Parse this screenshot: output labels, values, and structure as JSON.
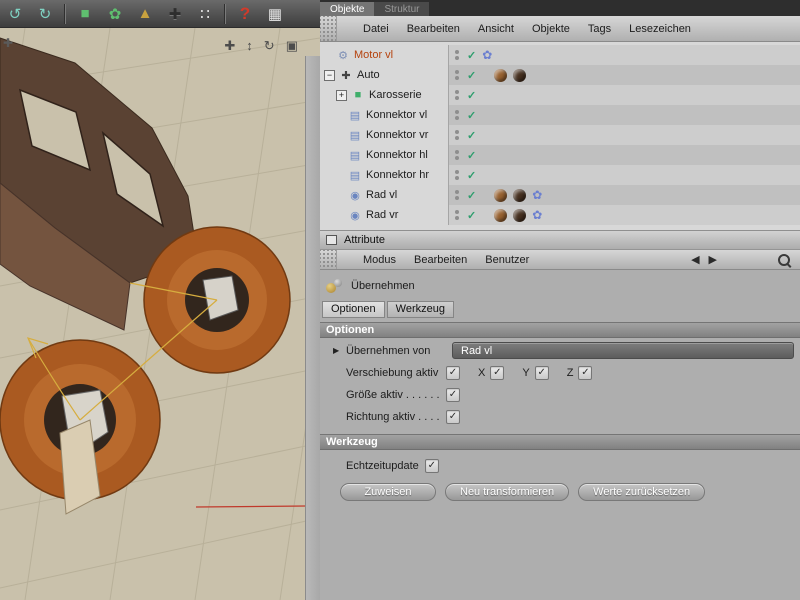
{
  "colors": {
    "accent_selected_object": "#b5430e",
    "check_green": "#2f9e6e",
    "wheel_orange": "#aa5a21",
    "body_brown": "#5a4233"
  },
  "toolbar": {
    "icons": [
      {
        "name": "undo",
        "glyph": "↺"
      },
      {
        "name": "redo",
        "glyph": "↻"
      },
      {
        "name": "cube-primitive",
        "glyph": "■"
      },
      {
        "name": "modeling-flower",
        "glyph": "✿"
      },
      {
        "name": "cone-primitive",
        "glyph": "▲"
      },
      {
        "name": "move-tool",
        "glyph": "✚"
      },
      {
        "name": "particles",
        "glyph": "∷"
      },
      {
        "name": "help",
        "glyph": "?"
      },
      {
        "name": "content-browser",
        "glyph": "▦"
      }
    ]
  },
  "viewport": {
    "nav": [
      {
        "name": "pan",
        "glyph": "✚"
      },
      {
        "name": "dolly",
        "glyph": "↕"
      },
      {
        "name": "rotate",
        "glyph": "↻"
      },
      {
        "name": "toggle-view",
        "glyph": "▣"
      }
    ],
    "corner_glyph": "✚"
  },
  "object_manager": {
    "tabs": [
      {
        "label": "Objekte"
      },
      {
        "label": "Struktur"
      }
    ],
    "menu": [
      "Datei",
      "Bearbeiten",
      "Ansicht",
      "Objekte",
      "Tags",
      "Lesezeichen"
    ],
    "rows": [
      {
        "label": "Motor vl"
      },
      {
        "label": "Auto"
      },
      {
        "label": "Karosserie"
      },
      {
        "label": "Konnektor vl"
      },
      {
        "label": "Konnektor vr"
      },
      {
        "label": "Konnektor hl"
      },
      {
        "label": "Konnektor hr"
      },
      {
        "label": "Rad vl"
      },
      {
        "label": "Rad vr"
      }
    ],
    "expander_minus": "−",
    "expander_plus": "+"
  },
  "attributes": {
    "title": "Attribute",
    "menu": [
      "Modus",
      "Bearbeiten",
      "Benutzer"
    ],
    "nav_back": "◀",
    "nav_forward": "▶",
    "command": "Übernehmen",
    "tabs": [
      "Optionen",
      "Werkzeug"
    ],
    "section_optionen": "Optionen",
    "section_werkzeug": "Werkzeug",
    "fields": {
      "uebernehmen_von_label": "Übernehmen von",
      "uebernehmen_von_value": "Rad vl",
      "verschiebung_label": "Verschiebung aktiv",
      "axis_x": "X",
      "axis_y": "Y",
      "axis_z": "Z",
      "groesse_label": "Größe aktiv . . . . . .",
      "richtung_label": "Richtung aktiv . . . .",
      "echtzeit_label": "Echtzeitupdate",
      "check_glyph": "✓"
    },
    "buttons": [
      "Zuweisen",
      "Neu transformieren",
      "Werte zurücksetzen"
    ]
  }
}
